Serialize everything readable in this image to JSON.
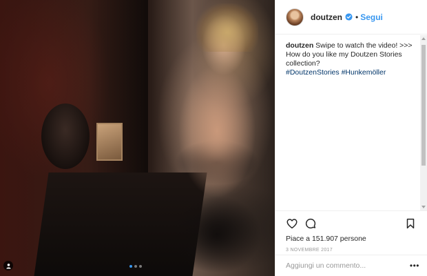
{
  "author": {
    "username": "doutzen",
    "separator": "•",
    "follow_label": "Segui"
  },
  "caption": {
    "username": "doutzen",
    "text": " Swipe to watch the video! >>> How do you like my Doutzen Stories collection?",
    "hashtags": [
      "#DoutzenStories",
      "#Hunkemöller"
    ]
  },
  "carousel": {
    "count": 3,
    "active_index": 0
  },
  "engagement": {
    "likes_text": "Piace a 151.907 persone",
    "date": "3 NOVEMBRE 2017"
  },
  "comment_box": {
    "placeholder": "Aggiungi un commento...",
    "more_label": "•••"
  },
  "icons": {
    "verified": "verified-badge-icon",
    "like": "heart-icon",
    "comment": "comment-bubble-icon",
    "save": "bookmark-icon",
    "user_tag": "user-tag-icon"
  },
  "colors": {
    "accent": "#3897f0",
    "hashtag": "#003569",
    "text": "#262626",
    "muted": "#999999",
    "border": "#efefef"
  }
}
